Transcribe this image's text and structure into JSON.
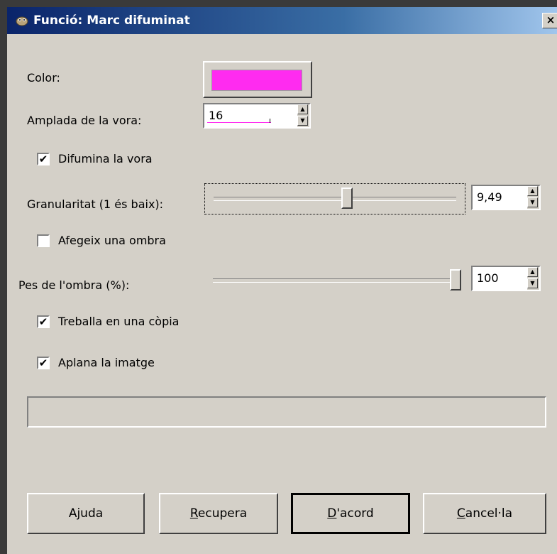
{
  "window": {
    "title": "Funció: Marc difuminat",
    "close_label": "×"
  },
  "fields": {
    "color_label": "Color:",
    "color_value": "#ff2bf0",
    "border_width_label": "Amplada de la vora:",
    "border_width_value": "16",
    "blur_border_label": "Difumina la vora",
    "blur_border_checked": true,
    "granularity_label": "Granularitat (1 és baix):",
    "granularity_value": "9,49",
    "granularity_slider_fraction": 0.55,
    "add_shadow_label": "Afegeix una ombra",
    "add_shadow_checked": false,
    "shadow_weight_label": "Pes de l'ombra (%):",
    "shadow_weight_value": "100",
    "shadow_weight_fraction": 1.0,
    "work_on_copy_label": "Treballa en una còpia",
    "work_on_copy_checked": true,
    "flatten_label": "Aplana la imatge",
    "flatten_checked": true
  },
  "buttons": {
    "help_label": "Ajuda",
    "reset_mnemonic": "R",
    "reset_rest": "ecupera",
    "ok_mnemonic": "D",
    "ok_rest": "'acord",
    "cancel_mnemonic": "C",
    "cancel_rest": "ancel·la"
  },
  "icons": {
    "title_icon": "gimp-wilber-icon",
    "spin_up": "▲",
    "spin_down": "▼",
    "check": "✔"
  },
  "colors": {
    "face": "#d4d0c8",
    "title_start": "#0a246a",
    "title_end": "#a6caf0"
  }
}
